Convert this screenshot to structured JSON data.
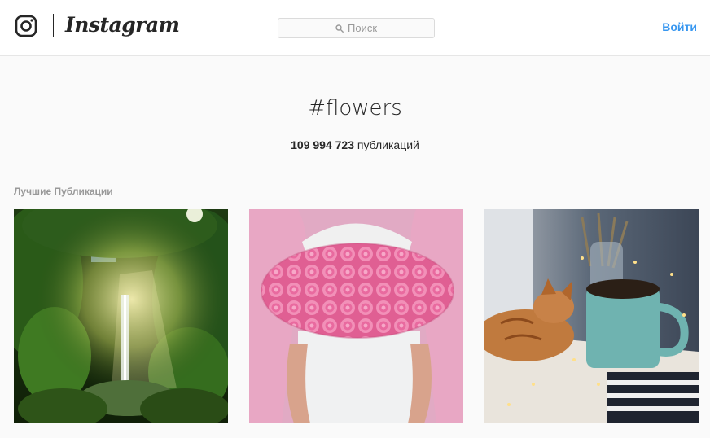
{
  "header": {
    "logo_wordmark": "Instagram",
    "search_placeholder": "Поиск",
    "login_label": "Войти",
    "accent_color": "#3897f0"
  },
  "hashtag": {
    "title": "#flowers",
    "post_count": "109 994 723",
    "post_count_suffix": "публикаций"
  },
  "section": {
    "label": "Лучшие Публикации"
  },
  "top_posts": [
    {
      "subject": "waterfall in a sunlit jungle"
    },
    {
      "subject": "hat box filled with pink roses"
    },
    {
      "subject": "cat sleeping beside a blue mug with fairy lights"
    }
  ]
}
